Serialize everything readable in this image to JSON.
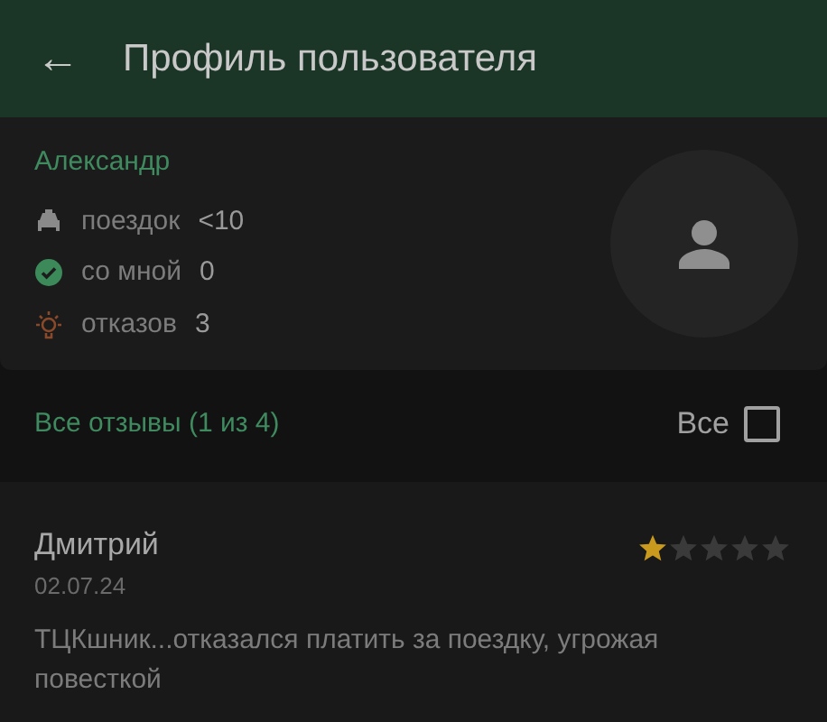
{
  "header": {
    "back": "←",
    "title": "Профиль пользователя"
  },
  "profile": {
    "name": "Александр",
    "stats": [
      {
        "kind": "trips",
        "label": "поездок",
        "value": "<10"
      },
      {
        "kind": "with_me",
        "label": "со мной",
        "value": "0"
      },
      {
        "kind": "refusals",
        "label": "отказов",
        "value": "3"
      }
    ]
  },
  "reviews_bar": {
    "title": "Все отзывы (1 из 4)",
    "filter_label": "Все",
    "checked": false
  },
  "reviews": [
    {
      "author": "Дмитрий",
      "date": "02.07.24",
      "stars": 1,
      "text": "ТЦКшник...отказался платить за поездку, угрожая повесткой"
    }
  ]
}
